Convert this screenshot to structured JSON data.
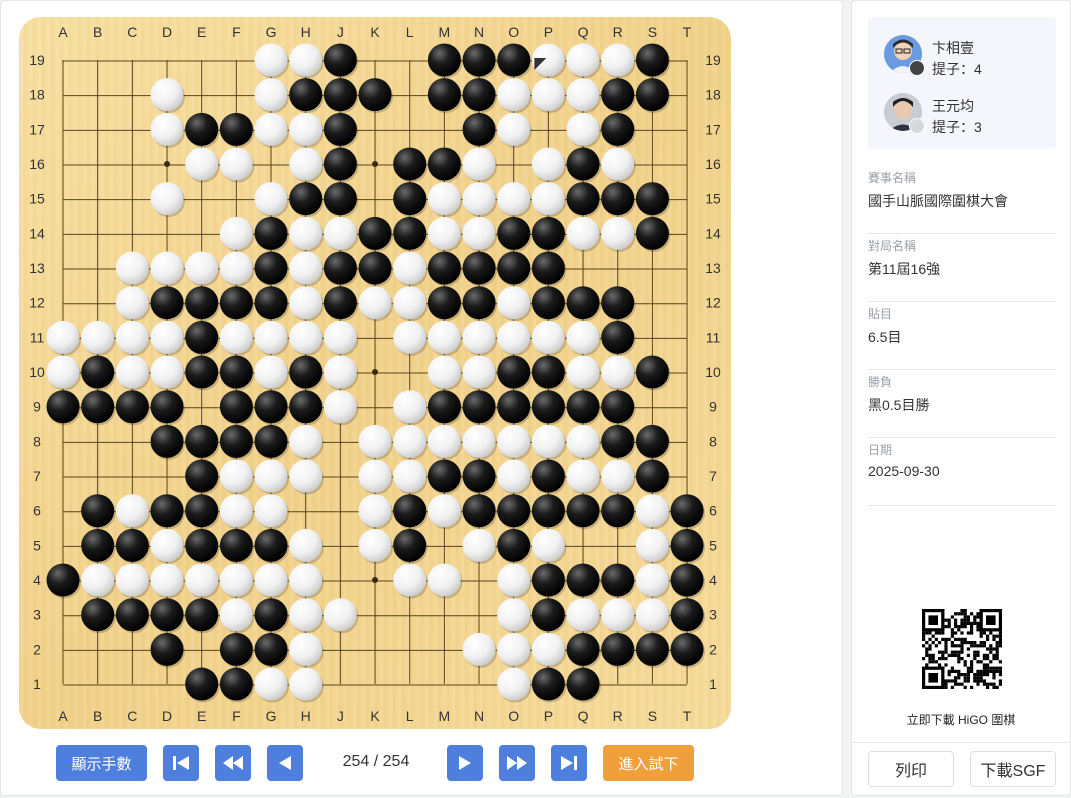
{
  "board": {
    "columns": [
      "A",
      "B",
      "C",
      "D",
      "E",
      "F",
      "G",
      "H",
      "J",
      "K",
      "L",
      "M",
      "N",
      "O",
      "P",
      "Q",
      "R",
      "S",
      "T"
    ],
    "rows": [
      "19",
      "18",
      "17",
      "16",
      "15",
      "14",
      "13",
      "12",
      "11",
      "10",
      "9",
      "8",
      "7",
      "6",
      "5",
      "4",
      "3",
      "2",
      "1"
    ],
    "position": [
      "......WWB..BBBWWWB.",
      "...W..WBBB.BBWWWBB.",
      "...WBBWWB...BW.WB..",
      "....WW.WB.BBW.WBW..",
      "...W..WBB.BWWWWBBB.",
      ".....WBWWBBWWBBWWB.",
      "..WWWWBWBBWBBBB....",
      "..WBBBBWBWWBBWBBB..",
      "WWWWBWWWW.WWWWWWB..",
      "WBWWBBWBW..WWBBWWB.",
      "BBBB.BBBW.WBBBBBB..",
      "...BBBBW.WWWWWWWBB.",
      "....BWWW.WWBBWBWWB.",
      ".BWBBWW..WBWBBBBBWB",
      ".BBWBBBW.WB.WBW..WB",
      "BWWWWWWW..WW.WBBBWB",
      ".BBBBWBWW....WBWWWB",
      "...B.BBW....WWWBBBB",
      "....BBWW.....WBB..."
    ],
    "last_move": "P19",
    "star_points": [
      "D16",
      "K16",
      "Q16",
      "D10",
      "K10",
      "Q10",
      "D4",
      "K4",
      "Q4"
    ]
  },
  "controls": {
    "show_moves_label": "顯示手數",
    "first_icon": "skip-to-start-icon",
    "prev_many_icon": "fast-rewind-icon",
    "prev_icon": "step-back-icon",
    "move_counter": "254 / 254",
    "next_icon": "step-forward-icon",
    "next_many_icon": "fast-forward-icon",
    "last_icon": "skip-to-end-icon",
    "try_label": "進入試下"
  },
  "players": [
    {
      "name": "卞相壹",
      "captures": "提子：4",
      "color": "black"
    },
    {
      "name": "王元均",
      "captures": "提子：3",
      "color": "white"
    }
  ],
  "info": [
    {
      "label": "賽事名稱",
      "value": "國手山脈國際圍棋大會"
    },
    {
      "label": "對局名稱",
      "value": "第11屆16強"
    },
    {
      "label": "貼目",
      "value": "6.5目"
    },
    {
      "label": "勝負",
      "value": "黑0.5目勝"
    },
    {
      "label": "日期",
      "value": "2025-09-30"
    }
  ],
  "qr_caption": "立即下載 HiGO 圍棋",
  "footer": {
    "print_label": "列印",
    "download_label": "下載SGF"
  },
  "colors": {
    "accent_blue": "#4e7fdd",
    "accent_orange": "#f0a03a",
    "board_wood": "#f3d48e"
  }
}
